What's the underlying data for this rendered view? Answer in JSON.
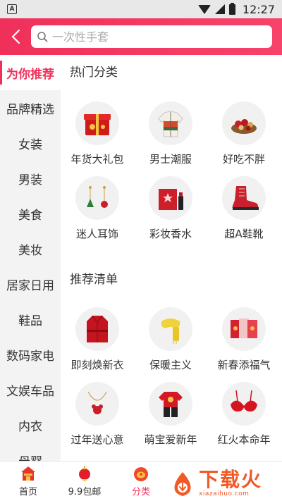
{
  "status_bar": {
    "time": "12:27",
    "notification_icon": "A"
  },
  "header": {
    "search_placeholder": "一次性手套"
  },
  "sidebar": {
    "items": [
      {
        "label": "为你推荐",
        "active": true
      },
      {
        "label": "品牌精选"
      },
      {
        "label": "女装"
      },
      {
        "label": "男装"
      },
      {
        "label": "美食"
      },
      {
        "label": "美妆"
      },
      {
        "label": "居家日用"
      },
      {
        "label": "鞋品"
      },
      {
        "label": "数码家电"
      },
      {
        "label": "文娱车品"
      },
      {
        "label": "内衣"
      },
      {
        "label": "母婴"
      }
    ]
  },
  "sections": [
    {
      "title": "热门分类",
      "items": [
        {
          "label": "年货大礼包",
          "icon": "gift-box-icon"
        },
        {
          "label": "男士潮服",
          "icon": "jacket-icon"
        },
        {
          "label": "好吃不胖",
          "icon": "snacks-icon"
        },
        {
          "label": "迷人耳饰",
          "icon": "earrings-icon"
        },
        {
          "label": "彩妆香水",
          "icon": "perfume-icon"
        },
        {
          "label": "超A鞋靴",
          "icon": "boot-icon"
        }
      ]
    },
    {
      "title": "推荐清单",
      "items": [
        {
          "label": "即刻焕新衣",
          "icon": "red-coat-icon"
        },
        {
          "label": "保暖主义",
          "icon": "scarf-icon"
        },
        {
          "label": "新春添福气",
          "icon": "red-envelope-icon"
        },
        {
          "label": "过年送心意",
          "icon": "necklace-icon"
        },
        {
          "label": "萌宝爱新年",
          "icon": "baby-outfit-icon"
        },
        {
          "label": "红火本命年",
          "icon": "red-bra-icon"
        }
      ]
    }
  ],
  "bottom_nav": {
    "items": [
      {
        "label": "首页",
        "icon": "home-icon"
      },
      {
        "label": "9.9包邮",
        "icon": "lantern-icon"
      },
      {
        "label": "分类",
        "icon": "category-icon",
        "active": true
      }
    ]
  },
  "watermark": {
    "main": "下载火",
    "sub": "xiazaihuo.com"
  },
  "colors": {
    "accent": "#f0305a",
    "sidebar_bg": "#f3f3f3",
    "watermark": "#f05a28"
  }
}
